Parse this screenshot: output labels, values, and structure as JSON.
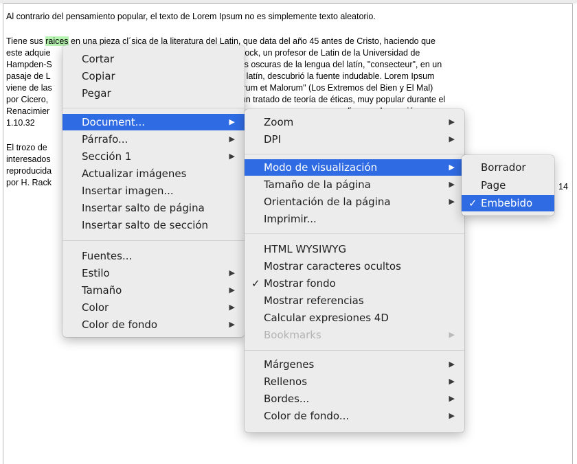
{
  "document": {
    "para1": "Al contrario del pensamiento popular, el texto de Lorem Ipsum no es simplemente texto aleatorio.",
    "para2_lines": [
      {
        "before": "Tiene sus ",
        "highlight": "raices",
        "after": " en una pieza cl´sica de la literatura del Latin, que data del año 45 antes de Cristo, haciendo que"
      },
      {
        "text": "este adquie                                                        Richard McClintock, un profesor de Latin de la Universidad de"
      },
      {
        "text": "Hampden-S                                                          s palabras más oscuras de la lengua del latín, \"consecteur\", en un"
      },
      {
        "text": "pasaje de L                                                          ntos textos del latín, descubrió la fuente indudable. Lorem Ipsum"
      },
      {
        "text": "viene de las                                                         Finnibus Bonorum et Malorum\" (Los Extremos del Bien y El Mal)"
      },
      {
        "text": "por Cicero,                                                            Este libro es un tratado de teoría de éticas, muy popular durante el"
      },
      {
        "text": "Renacimier                                                                                                                          a linea en la sección"
      },
      {
        "text": "1.10.32"
      }
    ],
    "para3_lines": [
      "El trozo de",
      "interesados",
      "reproducida",
      "por H. Rack"
    ],
    "right_fragment": "14"
  },
  "menu1": {
    "items": [
      "Cortar",
      "Copiar",
      "Pegar",
      "Document...",
      "Párrafo...",
      "Sección 1",
      "Actualizar imágenes",
      "Insertar imagen...",
      "Insertar salto de página",
      "Insertar salto de sección",
      "Fuentes...",
      "Estilo",
      "Tamaño",
      "Color",
      "Color de fondo"
    ]
  },
  "menu2": {
    "items": [
      "Zoom",
      "DPI",
      "Modo de visualización",
      "Tamaño de la página",
      "Orientación de la página",
      "Imprimir...",
      "HTML WYSIWYG",
      "Mostrar caracteres ocultos",
      "Mostrar fondo",
      "Mostrar referencias",
      "Calcular expresiones 4D",
      "Bookmarks",
      "Márgenes",
      "Rellenos",
      "Bordes...",
      "Color de fondo..."
    ]
  },
  "menu3": {
    "items": [
      "Borrador",
      "Page",
      "Embebido"
    ]
  },
  "glyphs": {
    "arrow": "▶",
    "check": "✓"
  },
  "colors": {
    "highlight": "#2f6be3",
    "text_highlight": "#b6f2b0"
  }
}
